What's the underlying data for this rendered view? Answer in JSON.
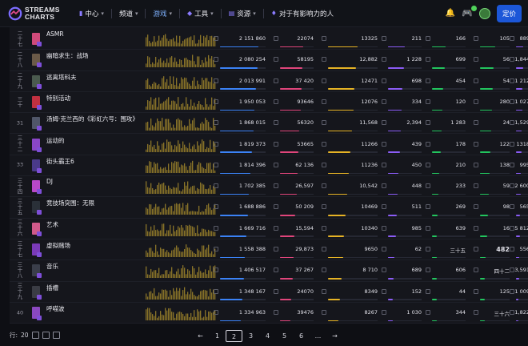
{
  "brand": {
    "line1": "STREAMS",
    "line2": "CHARTS"
  },
  "nav": [
    {
      "label": "中心",
      "icon": "bar-chart-icon",
      "glyph": "▮",
      "active": false,
      "chevron": true
    },
    {
      "label": "频道",
      "icon": "",
      "glyph": "",
      "active": false,
      "chevron": true
    },
    {
      "label": "游戏",
      "icon": "",
      "glyph": "",
      "active": true,
      "chevron": true
    },
    {
      "label": "工具",
      "icon": "diamond-icon",
      "glyph": "◆",
      "active": false,
      "chevron": true
    },
    {
      "label": "资源",
      "icon": "resources-icon",
      "glyph": "▤",
      "active": false,
      "chevron": true
    },
    {
      "label": "对于有影响力的人",
      "icon": "influencer-icon",
      "glyph": "♦",
      "active": false,
      "chevron": false
    }
  ],
  "header_right": {
    "price_label": "定价"
  },
  "colors": {
    "accent": "#1c57d8",
    "bar_blue": "#3b82f6",
    "bar_pink": "#e0457b",
    "bar_yellow": "#e6b325",
    "bar_purple": "#8b5cf6",
    "bar_green": "#22c55e"
  },
  "rows": [
    {
      "rank": "二\n十\n七",
      "name": "ASMR",
      "v1": "2 151 860",
      "v2": "22074",
      "v3": "13325",
      "v4": "211",
      "v5": "166",
      "v6": "105",
      "v7": "889",
      "thumb": "#d04a7a"
    },
    {
      "rank": "二\n十\n八",
      "name": "幽暗求生：战场",
      "v1": "2 080 254",
      "v2": "58195",
      "v3": "12,882",
      "v4": "1 228",
      "v5": "699",
      "v6": "56",
      "v7": "1,844",
      "thumb": "#6b5a48"
    },
    {
      "rank": "二\n十\n九",
      "name": "逃离塔科夫",
      "v1": "2 013 991",
      "v2": "37 420",
      "v3": "12471",
      "v4": "698",
      "v5": "454",
      "v6": "54",
      "v7": "1 212",
      "thumb": "#4a5a4e"
    },
    {
      "rank": "三\n十",
      "name": "特别活动",
      "v1": "1 950 053",
      "v2": "93646",
      "v3": "12076",
      "v4": "334",
      "v5": "120",
      "v6": "280",
      "v7": "1 027",
      "thumb": "#c03040"
    },
    {
      "rank": "31",
      "name": "汤姆·克兰西的《彩虹六号：围攻》",
      "v1": "1 868 015",
      "v2": "56320",
      "v3": "11,568",
      "v4": "2,394",
      "v5": "1 283",
      "v6": "24",
      "v7": "1,529",
      "thumb": "#505668"
    },
    {
      "rank": "三\n十\n二",
      "name": "运动的",
      "v1": "1 819 373",
      "v2": "53665",
      "v3": "11266",
      "v4": "439",
      "v5": "178",
      "v6": "122",
      "v7": "1318",
      "thumb": "#8a46c8"
    },
    {
      "rank": "33",
      "name": "街头霸王6",
      "v1": "1 814 396",
      "v2": "62 136",
      "v3": "11236",
      "v4": "450",
      "v5": "210",
      "v6": "138",
      "v7": "995",
      "thumb": "#4a3a8a"
    },
    {
      "rank": "三\n十\n四",
      "name": "DJ",
      "v1": "1 702 385",
      "v2": "26,597",
      "v3": "10,542",
      "v4": "448",
      "v5": "233",
      "v6": "59",
      "v7": "2 600",
      "thumb": "#b848c8"
    },
    {
      "rank": "三\n十\n五",
      "name": "竞技场突围：无限",
      "v1": "1 688 886",
      "v2": "50 209",
      "v3": "10469",
      "v4": "511",
      "v5": "269",
      "v6": "98",
      "v7": "565",
      "thumb": "#2a3038"
    },
    {
      "rank": "三\n十\n六",
      "name": "艺术",
      "v1": "1 669 716",
      "v2": "15,594",
      "v3": "10340",
      "v4": "985",
      "v5": "639",
      "v6": "16",
      "v7": "5 812",
      "thumb": "#d05a8a"
    },
    {
      "rank": "三\n十\n七",
      "name": "虚拟赌场",
      "v1": "1 558 388",
      "v2": "29,873",
      "v3": "9650",
      "v4": "62",
      "v5": "三十五",
      "v6": "482",
      "v7": "556",
      "thumb": "#7a3ab8"
    },
    {
      "rank": "三\n十\n八",
      "name": "音乐",
      "v1": "1 406 517",
      "v2": "37 267",
      "v3": "8 710",
      "v4": "689",
      "v5": "606",
      "v6": "四十二",
      "v7": "3,591",
      "thumb": "#3a3e4a"
    },
    {
      "rank": "三\n十\n九",
      "name": "插槽",
      "v1": "1 348 167",
      "v2": "24070",
      "v3": "8349",
      "v4": "152",
      "v5": "44",
      "v6": "125",
      "v7": "1 009",
      "thumb": "#3a3c44"
    },
    {
      "rank": "40",
      "name": "呼喵波",
      "v1": "1 334 963",
      "v2": "39476",
      "v3": "8267",
      "v4": "1 030",
      "v5": "344",
      "v6": "三十六",
      "v7": "1,822",
      "thumb": "#8a48c0"
    }
  ],
  "partial_top_rank": "六",
  "pagination": {
    "rows_label": "行:",
    "rows_value": "20",
    "pages": [
      "1",
      "2",
      "3",
      "4",
      "5",
      "6",
      "..."
    ],
    "active_page": "2",
    "prev": "←",
    "next": "→"
  }
}
